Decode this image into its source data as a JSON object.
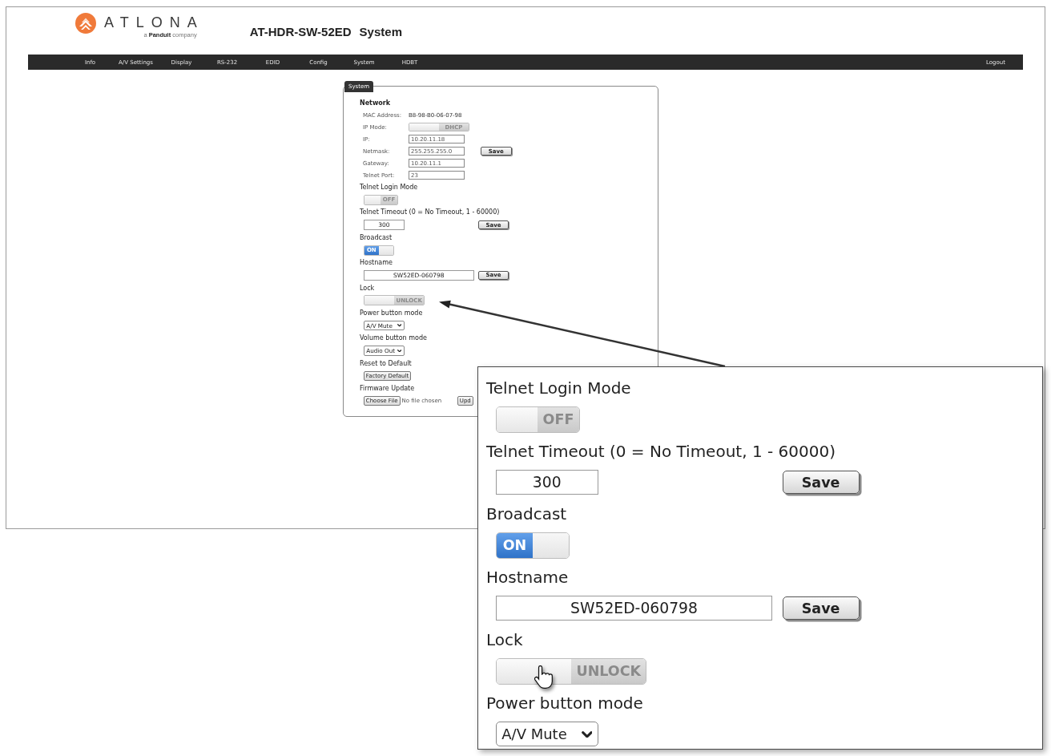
{
  "header": {
    "logo": {
      "wordmark": "ATLONA",
      "tagline": "a **Panduit** company"
    },
    "device": "AT-HDR-SW-52ED",
    "page": "System"
  },
  "nav": {
    "items": [
      "Info",
      "A/V Settings",
      "Display",
      "RS-232",
      "EDID",
      "Config",
      "System",
      "HDBT"
    ],
    "logout": "Logout"
  },
  "system_panel": {
    "legend": "System",
    "network": {
      "heading": "Network",
      "fields": [
        {
          "kind": "text",
          "label": "MAC Address:",
          "value": "B8-98-B0-06-07-98"
        },
        {
          "kind": "toggle",
          "label": "IP Mode:",
          "toggle": {
            "label": "DHCP",
            "on": false
          }
        },
        {
          "kind": "input",
          "label": "IP:",
          "value": "10.20.11.18"
        },
        {
          "kind": "input",
          "label": "Netmask:",
          "value": "255.255.255.0"
        },
        {
          "kind": "input",
          "label": "Gateway:",
          "value": "10.20.11.1"
        },
        {
          "kind": "input",
          "label": "Telnet Port:",
          "value": "23"
        }
      ],
      "save": "Save"
    },
    "settings": [
      {
        "kind": "toggle",
        "heading": "Telnet Login Mode",
        "toggle": {
          "label": "OFF",
          "on": false
        }
      },
      {
        "kind": "number_input",
        "heading": "Telnet Timeout (0 = No Timeout, 1 - 60000)",
        "value": "300",
        "button": "Save"
      },
      {
        "kind": "toggle",
        "heading": "Broadcast",
        "toggle": {
          "label": "ON",
          "on": true
        }
      },
      {
        "kind": "text_input",
        "heading": "Hostname",
        "value": "SW52ED-060798",
        "button": "Save"
      },
      {
        "kind": "toggle",
        "heading": "Lock",
        "toggle": {
          "label": "UNLOCK",
          "on": false
        }
      },
      {
        "kind": "select",
        "heading": "Power button mode",
        "value": "A/V Mute"
      },
      {
        "kind": "select",
        "heading": "Volume button mode",
        "value": "Audio Out"
      },
      {
        "kind": "button",
        "heading": "Reset to Default",
        "button": "Factory Default"
      },
      {
        "kind": "file",
        "heading": "Firmware Update",
        "choose": "Choose File",
        "status": "No file chosen",
        "button": "Upd"
      }
    ]
  },
  "callout": {
    "settings": [
      {
        "kind": "toggle",
        "heading": "Telnet Login Mode",
        "toggle": {
          "label": "OFF",
          "on": false
        }
      },
      {
        "kind": "number_input",
        "heading": "Telnet Timeout (0 = No Timeout, 1 - 60000)",
        "value": "300",
        "button": "Save"
      },
      {
        "kind": "toggle",
        "heading": "Broadcast",
        "toggle": {
          "label": "ON",
          "on": true
        }
      },
      {
        "kind": "text_input",
        "heading": "Hostname",
        "value": "SW52ED-060798",
        "button": "Save"
      },
      {
        "kind": "toggle",
        "heading": "Lock",
        "toggle": {
          "label": "UNLOCK",
          "on": false
        }
      },
      {
        "kind": "select",
        "heading": "Power button mode",
        "value": "A/V Mute"
      }
    ]
  }
}
